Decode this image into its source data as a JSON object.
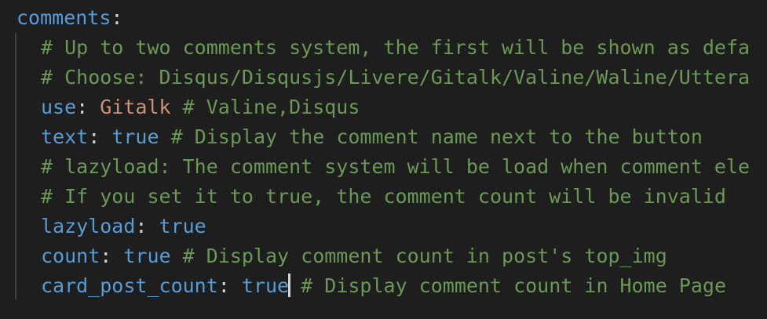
{
  "editor": {
    "lines": [
      {
        "key": "comments",
        "sep": ":"
      },
      {
        "comment": "# Up to two comments system, the first will be shown as defa"
      },
      {
        "comment": "# Choose: Disqus/Disqusjs/Livere/Gitalk/Valine/Waline/Uttera"
      },
      {
        "key": "use",
        "sep": ": ",
        "string": "Gitalk",
        "comment": " # Valine,Disqus"
      },
      {
        "key": "text",
        "sep": ": ",
        "bool": "true",
        "comment": " # Display the comment name next to the button"
      },
      {
        "comment": "# lazyload: The comment system will be load when comment ele"
      },
      {
        "comment": "# If you set it to true, the comment count will be invalid"
      },
      {
        "key": "lazyload",
        "sep": ": ",
        "bool": "true"
      },
      {
        "key": "count",
        "sep": ": ",
        "bool": "true",
        "comment": " # Display comment count in post's top_img"
      },
      {
        "key": "card_post_count",
        "sep": ": ",
        "bool": "true",
        "comment": " # Display comment count in Home Page"
      }
    ]
  }
}
